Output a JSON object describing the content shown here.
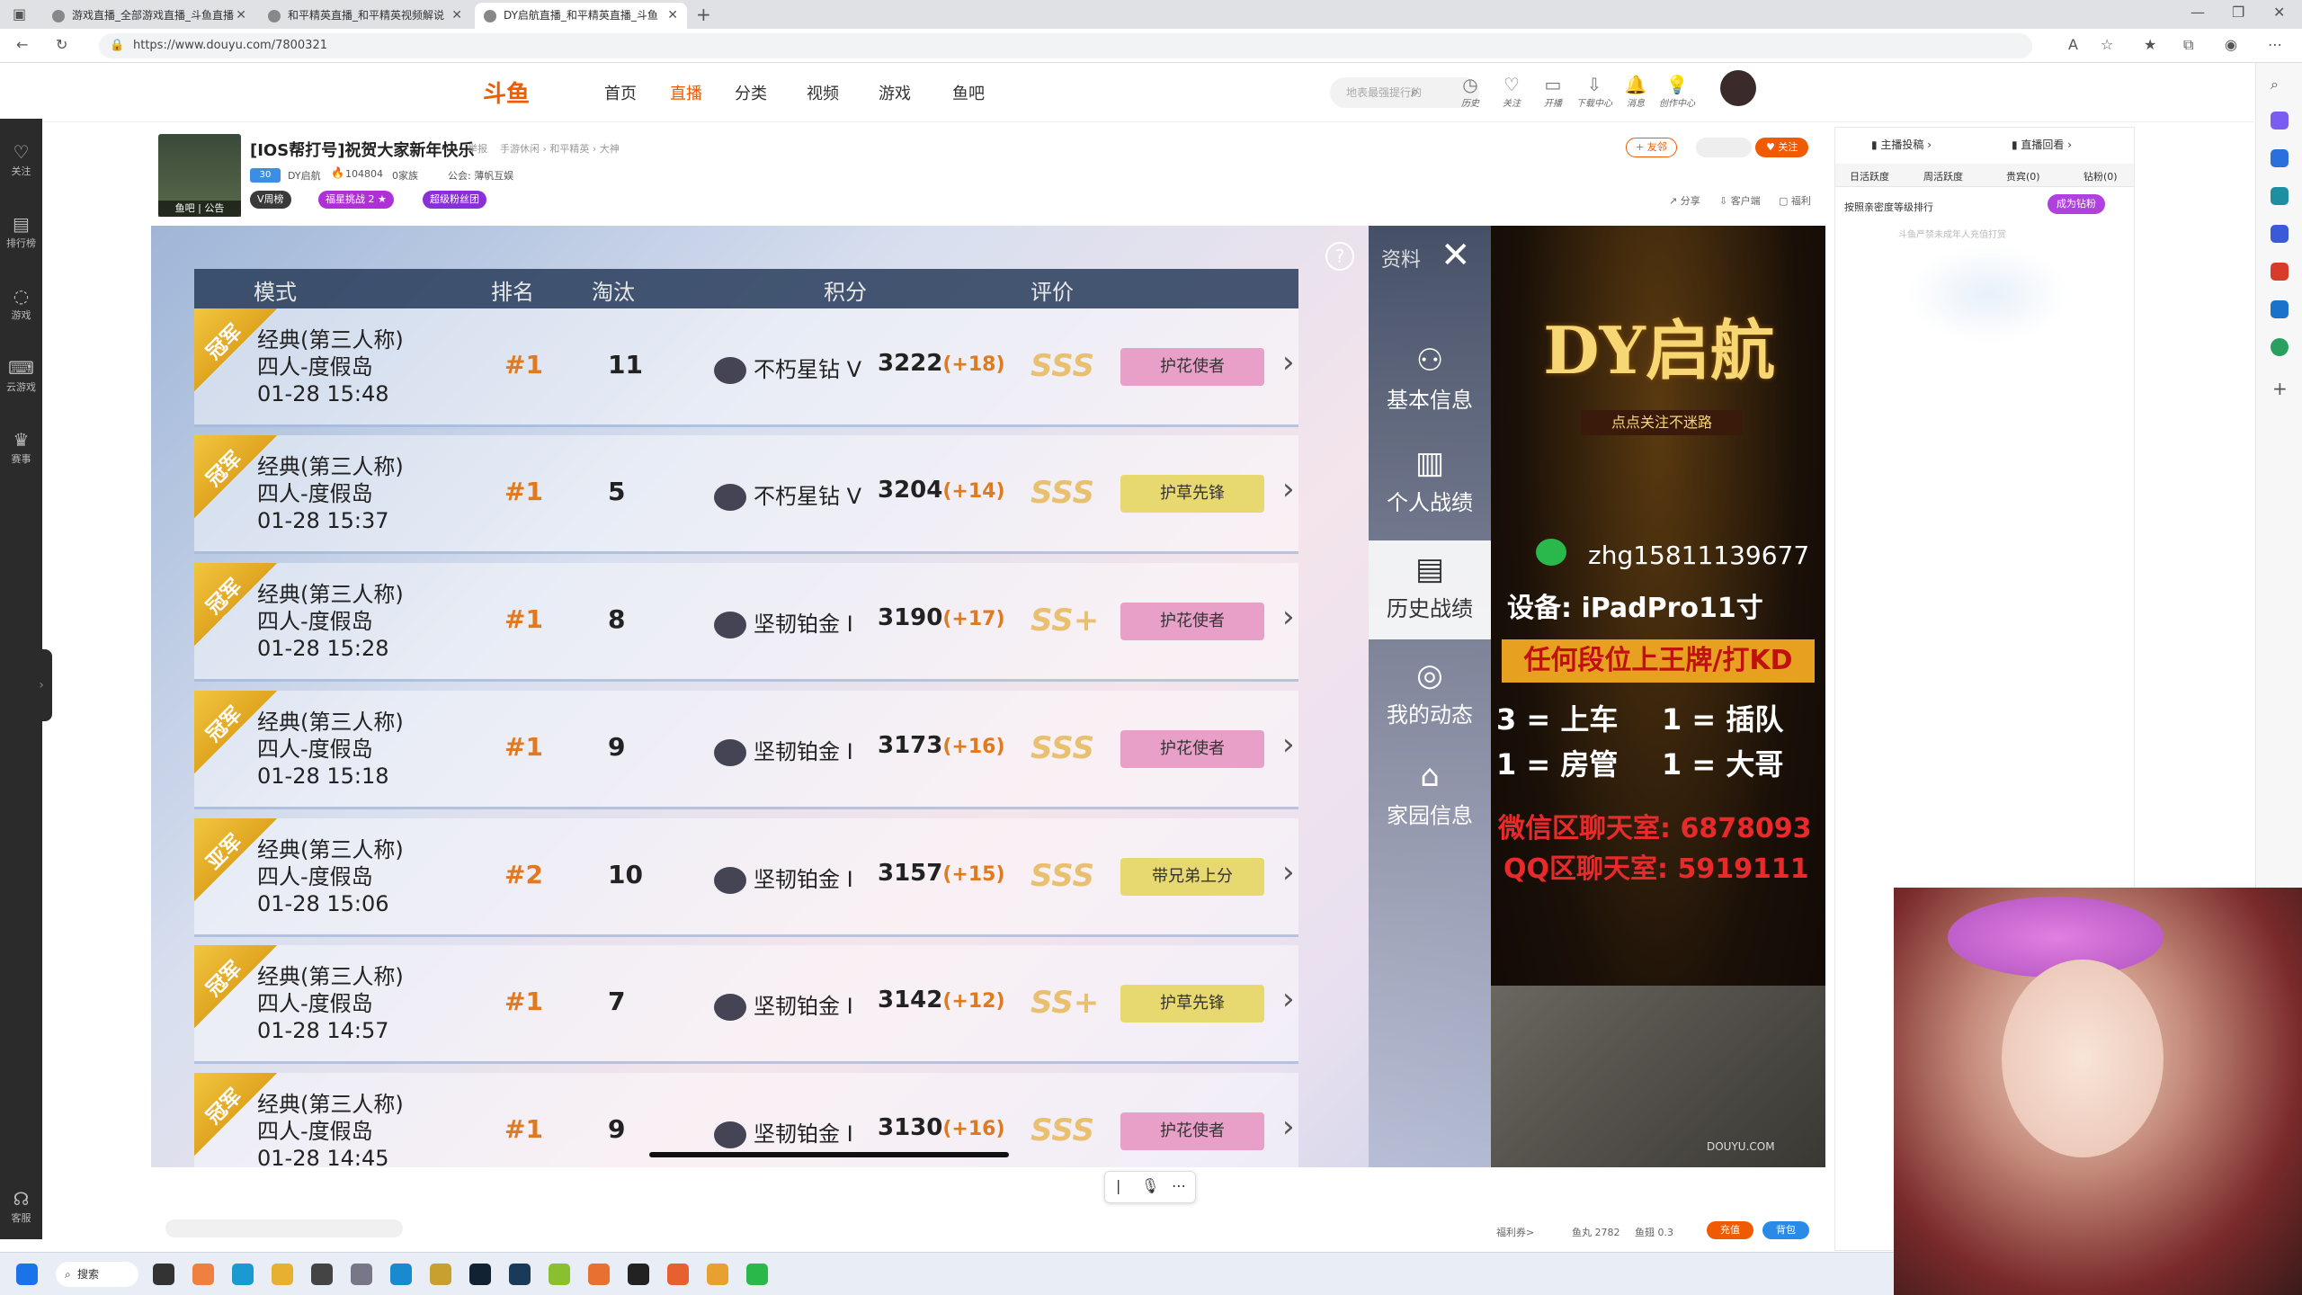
{
  "tabs": [
    {
      "label": "游戏直播_全部游戏直播_斗鱼直播",
      "active": false
    },
    {
      "label": "和平精英直播_和平精英视频解说",
      "active": false
    },
    {
      "label": "DY启航直播_和平精英直播_斗鱼",
      "active": true
    }
  ],
  "address": {
    "url": "https://www.douyu.com/7800321"
  },
  "rail": [
    "关注",
    "排行榜",
    "游戏",
    "云游戏",
    "赛事",
    "客服"
  ],
  "site": {
    "logo": "斗鱼",
    "nav": [
      "首页",
      "直播",
      "分类",
      "视频",
      "游戏",
      "鱼吧"
    ],
    "active_nav": "直播",
    "search_placeholder": "地表最强提行的",
    "header_icons": [
      "历史",
      "关注",
      "开播",
      "下载中心",
      "消息",
      "创作中心"
    ]
  },
  "room": {
    "title": "[IOS帮打号]祝贺大家新年快乐",
    "report": "举报",
    "category_path": "手游休闲 › 和平精英 › 大神",
    "level_tag": "30",
    "streamer": "DY启航",
    "heat": "104804",
    "followers": "0家族",
    "guild": "公会: 薄帆互娱",
    "thumb_labels": [
      "鱼吧",
      "公告"
    ],
    "tags": [
      "V周榜",
      "福星挑战 2 ★",
      "超级粉丝团"
    ],
    "follow_count_label": "+ 友邻",
    "follow_button": "关注",
    "actions": [
      "分享",
      "客户端",
      "福利"
    ]
  },
  "game": {
    "columns": [
      "模式",
      "排名",
      "淘汰",
      "积分",
      "评价"
    ],
    "rows": [
      {
        "ribbon": "冠军",
        "mode": "经典(第三人称)",
        "map": "四人-度假岛",
        "time": "01-28 15:48",
        "rank": "#1",
        "kills": "11",
        "tier": "不朽星钻 V",
        "score": "3222",
        "delta": "(+18)",
        "grade": "SSS",
        "badge": "护花使者",
        "badge_color": "#e8a0c8"
      },
      {
        "ribbon": "冠军",
        "mode": "经典(第三人称)",
        "map": "四人-度假岛",
        "time": "01-28 15:37",
        "rank": "#1",
        "kills": "5",
        "tier": "不朽星钻 V",
        "score": "3204",
        "delta": "(+14)",
        "grade": "SSS",
        "badge": "护草先锋",
        "badge_color": "#e8d870"
      },
      {
        "ribbon": "冠军",
        "mode": "经典(第三人称)",
        "map": "四人-度假岛",
        "time": "01-28 15:28",
        "rank": "#1",
        "kills": "8",
        "tier": "坚韧铂金 I",
        "score": "3190",
        "delta": "(+17)",
        "grade": "SS+",
        "badge": "护花使者",
        "badge_color": "#e8a0c8"
      },
      {
        "ribbon": "冠军",
        "mode": "经典(第三人称)",
        "map": "四人-度假岛",
        "time": "01-28 15:18",
        "rank": "#1",
        "kills": "9",
        "tier": "坚韧铂金 I",
        "score": "3173",
        "delta": "(+16)",
        "grade": "SSS",
        "badge": "护花使者",
        "badge_color": "#e8a0c8"
      },
      {
        "ribbon": "亚军",
        "mode": "经典(第三人称)",
        "map": "四人-度假岛",
        "time": "01-28 15:06",
        "rank": "#2",
        "kills": "10",
        "tier": "坚韧铂金 I",
        "score": "3157",
        "delta": "(+15)",
        "grade": "SSS",
        "badge": "带兄弟上分",
        "badge_color": "#e8d870"
      },
      {
        "ribbon": "冠军",
        "mode": "经典(第三人称)",
        "map": "四人-度假岛",
        "time": "01-28 14:57",
        "rank": "#1",
        "kills": "7",
        "tier": "坚韧铂金 I",
        "score": "3142",
        "delta": "(+12)",
        "grade": "SS+",
        "badge": "护草先锋",
        "badge_color": "#e8d870"
      },
      {
        "ribbon": "冠军",
        "mode": "经典(第三人称)",
        "map": "四人-度假岛",
        "time": "01-28 14:45",
        "rank": "#1",
        "kills": "9",
        "tier": "坚韧铂金 I",
        "score": "3130",
        "delta": "(+16)",
        "grade": "SSS",
        "badge": "护花使者",
        "badge_color": "#e8a0c8"
      }
    ],
    "side_title": "资料",
    "side_items": [
      "基本信息",
      "个人战绩",
      "历史战绩",
      "我的动态",
      "家园信息"
    ],
    "active_side": "历史战绩"
  },
  "overlay": {
    "logo": "DY启航",
    "sub": "点点关注不迷路",
    "wechat": "zhg15811139677",
    "device": "设备: iPadPro11寸",
    "banner": "任何段位上王牌/打KD",
    "pricing": [
      "3 = 上车",
      "1 = 插队",
      "1 = 房管",
      "1 = 大哥"
    ],
    "wechat_room": "微信区聊天室: 6878093",
    "qq_room": "QQ区聊天室: 5919111",
    "watermark": "DOUYU.COM"
  },
  "chat": {
    "top_links": [
      "主播投稿",
      "直播回看"
    ],
    "tabs": [
      "日活跃度",
      "周活跃度",
      "贵宾(0)",
      "钻粉(0)"
    ],
    "rank_label": "按照亲密度等级排行",
    "become_fan": "成为钻粉",
    "notice": "斗鱼严禁未成年人充值打赏"
  },
  "footer_bar": {
    "benefit": "福利券>",
    "fish_balls": "鱼丸 2782",
    "fish_fins": "鱼翅 0.3",
    "recharge": "充值",
    "backpack": "背包"
  },
  "taskbar": {
    "search": "搜索"
  }
}
